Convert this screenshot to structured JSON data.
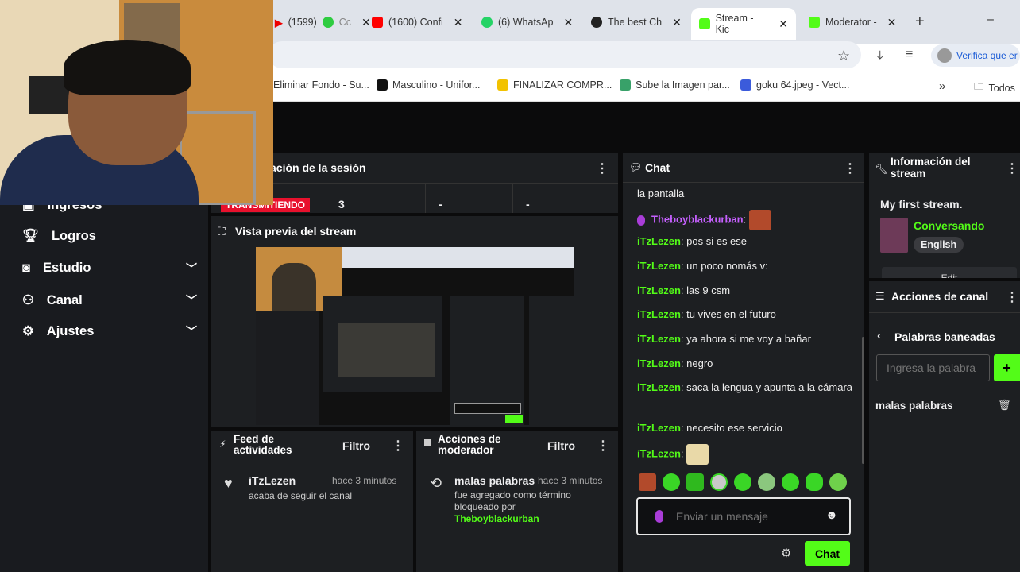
{
  "browser": {
    "tabs": [
      {
        "label": "(1599)",
        "extra": "Cc"
      },
      {
        "label": "(1600) Confi"
      },
      {
        "label": "(6) WhatsAp"
      },
      {
        "label": "The best Ch"
      },
      {
        "label": "Stream - Kic"
      },
      {
        "label": "Moderator -"
      }
    ],
    "new_tab": "+",
    "minimize": "–",
    "profile_text": "Verifica que er",
    "bookmarks": [
      "Eliminar Fondo - Su...",
      "Masculino - Unifor...",
      "FINALIZAR COMPR...",
      "Sube la Imagen par...",
      "goku 64.jpeg - Vect..."
    ],
    "bookmarks_more": "»",
    "all_bookmarks": "Todos"
  },
  "sidebar": {
    "items": [
      {
        "label": "Ingresos"
      },
      {
        "label": "Logros"
      },
      {
        "label": "Estudio"
      },
      {
        "label": "Canal"
      },
      {
        "label": "Ajustes"
      }
    ]
  },
  "session": {
    "title": "ación de la sesión",
    "status": "TRANSMITIENDO",
    "value1": "3",
    "value2": "-",
    "value3": "-"
  },
  "preview": {
    "title": "Vista previa del stream"
  },
  "feed": {
    "title": "Feed de actividades",
    "filter": "Filtro",
    "user": "iTzLezen",
    "time": "hace 3 minutos",
    "text": "acaba de seguir el canal"
  },
  "modactions": {
    "title": "Acciones de moderador",
    "filter": "Filtro",
    "term": "malas palabras",
    "time": "hace 3 minutos",
    "text": "fue agregado como término bloqueado por",
    "by": "Theboyblackurban"
  },
  "chat": {
    "title": "Chat",
    "top_line": "la pantalla",
    "messages": [
      {
        "user": "Theboyblackurban",
        "text": ""
      },
      {
        "user": "iTzLezen",
        "text": "pos si es ese"
      },
      {
        "user": "iTzLezen",
        "text": "un poco nomás v:"
      },
      {
        "user": "iTzLezen",
        "text": "las 9 csm"
      },
      {
        "user": "iTzLezen",
        "text": "tu vives en el futuro"
      },
      {
        "user": "iTzLezen",
        "text": "ya ahora si me voy a bañar"
      },
      {
        "user": "iTzLezen",
        "text": "negro"
      },
      {
        "user": "iTzLezen",
        "text": "saca la lengua y apunta a la cámara"
      },
      {
        "user": "iTzLezen",
        "text": "necesito ese servicio"
      },
      {
        "user": "iTzLezen",
        "text": ""
      }
    ],
    "input_placeholder": "Enviar un mensaje",
    "send_label": "Chat"
  },
  "info": {
    "title": "Información del stream",
    "stream_title": "My first stream.",
    "category": "Conversando",
    "language": "English",
    "edit_label": "Edit"
  },
  "channel_actions": {
    "title": "Acciones de canal",
    "sub_title": "Palabras baneadas",
    "input_placeholder": "Ingresa la palabra",
    "add_label": "+",
    "word": "malas palabras"
  },
  "colors": {
    "brand": "#53fc18",
    "live": "#e8112d",
    "panel": "#1d1f22",
    "bg": "#0b0b0c"
  }
}
